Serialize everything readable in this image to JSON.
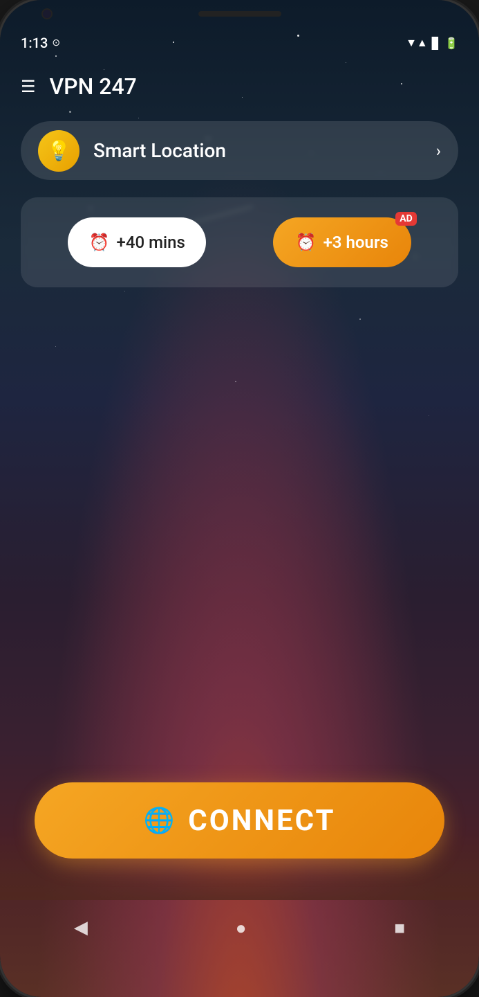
{
  "status": {
    "time": "1:13",
    "right_icons": [
      "▼",
      "▲",
      "🔋"
    ]
  },
  "header": {
    "menu_icon": "☰",
    "title": "VPN 247"
  },
  "location": {
    "label": "Smart Location",
    "arrow": "›"
  },
  "timer": {
    "option1_label": "+40 mins",
    "option2_label": "+3 hours",
    "ad_badge": "AD"
  },
  "connect": {
    "label": "CONNECT"
  },
  "nav": {
    "back": "◀",
    "home": "●",
    "recent": "■"
  }
}
